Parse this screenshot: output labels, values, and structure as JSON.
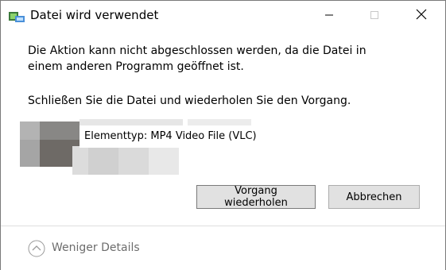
{
  "window": {
    "title": "Datei wird verwendet",
    "icon": "file-in-use-icon"
  },
  "caption_buttons": {
    "minimize_icon": "minimize-icon",
    "maximize_icon": "maximize-icon",
    "close_icon": "close-icon"
  },
  "message": {
    "line1": "Die Aktion kann nicht abgeschlossen werden, da die Datei in einem anderen Programm geöffnet ist.",
    "line2": "Schließen Sie die Datei und wiederholen Sie den Vorgang."
  },
  "file_info": {
    "item_type": "Elementtyp: MP4 Video File (VLC)"
  },
  "buttons": {
    "retry_label": "Vorgang wiederholen",
    "cancel_label": "Abbrechen"
  },
  "footer": {
    "details_label": "Weniger Details",
    "details_icon": "chevron-up-circle-icon"
  },
  "colors": {
    "button_bg": "#e1e1e1",
    "button_border": "#adadad",
    "footer_text": "#6d6d6d"
  }
}
